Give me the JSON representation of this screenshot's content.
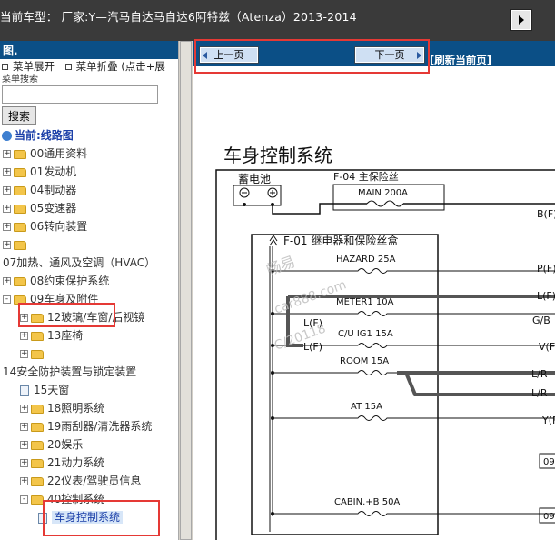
{
  "topbar": {
    "title": "当前车型： 厂家:Y—汽马自达马自达6阿特兹（Atenza）2013-2014",
    "button_icon": "play-icon"
  },
  "left": {
    "header": "图.",
    "expand_all": "菜单展开",
    "collapse_all": "菜单折叠 (点击+展",
    "search_label": "菜单搜索",
    "search_value": "",
    "search_button": "搜索",
    "current": "当前:线路图"
  },
  "tree": [
    {
      "label": "00通用资料",
      "indent": 0,
      "icon": "folder",
      "toggle": "+"
    },
    {
      "label": "01发动机",
      "indent": 0,
      "icon": "folder",
      "toggle": "+"
    },
    {
      "label": "04制动器",
      "indent": 0,
      "icon": "folder",
      "toggle": "+"
    },
    {
      "label": "05变速器",
      "indent": 0,
      "icon": "folder",
      "toggle": "+"
    },
    {
      "label": "06转向装置",
      "indent": 0,
      "icon": "folder",
      "toggle": "+"
    },
    {
      "label": "",
      "indent": 0,
      "icon": "folder",
      "toggle": "+"
    },
    {
      "label": "07加热、通风及空调（HVAC）",
      "indent": 0,
      "icon": "none",
      "toggle": ""
    },
    {
      "label": "08约束保护系统",
      "indent": 0,
      "icon": "folder",
      "toggle": "+"
    },
    {
      "label": "09车身及附件",
      "indent": 0,
      "icon": "folder-open",
      "toggle": "-"
    },
    {
      "label": "12玻璃/车窗/后视镜",
      "indent": 1,
      "icon": "folder",
      "toggle": "+"
    },
    {
      "label": "13座椅",
      "indent": 1,
      "icon": "folder",
      "toggle": "+"
    },
    {
      "label": "",
      "indent": 1,
      "icon": "folder",
      "toggle": "+"
    },
    {
      "label": "14安全防护装置与锁定装置",
      "indent": 0,
      "icon": "none",
      "toggle": ""
    },
    {
      "label": "15天窗",
      "indent": 1,
      "icon": "page",
      "toggle": ""
    },
    {
      "label": "18照明系统",
      "indent": 1,
      "icon": "folder",
      "toggle": "+"
    },
    {
      "label": "19雨刮器/清洗器系统",
      "indent": 1,
      "icon": "folder",
      "toggle": "+"
    },
    {
      "label": "20娱乐",
      "indent": 1,
      "icon": "folder",
      "toggle": "+"
    },
    {
      "label": "21动力系统",
      "indent": 1,
      "icon": "folder",
      "toggle": "+"
    },
    {
      "label": "22仪表/驾驶员信息",
      "indent": 1,
      "icon": "folder",
      "toggle": "+"
    },
    {
      "label": "40控制系统",
      "indent": 1,
      "icon": "folder-open",
      "toggle": "-"
    },
    {
      "label": "车身控制系统",
      "indent": 2,
      "icon": "page",
      "toggle": "",
      "selected": true
    }
  ],
  "toolbar": {
    "prev": "上一页",
    "next": "下一页",
    "refresh": "[刷新当前页]"
  },
  "diagram": {
    "title": "车身控制系统",
    "battery": "蓄电池",
    "f04": "F-04 主保险丝",
    "main_fuse": "MAIN 200A",
    "f01": "F-01 继电器和保险丝盒",
    "fuses": [
      "HAZARD 25A",
      "METER1 10A",
      "C/U IG1 15A",
      "ROOM 15A",
      "AT 15A",
      "CABIN.+B 50A"
    ],
    "wires": [
      "B(F)",
      "P(F)",
      "L(F)",
      "G/B",
      "V(F)",
      "L/R",
      "L/R",
      "Y(F)",
      "L(F)",
      "L(F)"
    ],
    "labels09": [
      "09",
      "09"
    ],
    "watermark": [
      "畅易",
      "car888.com",
      "C/20118"
    ]
  }
}
